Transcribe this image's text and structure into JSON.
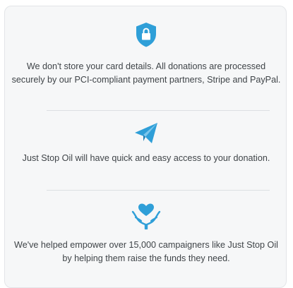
{
  "trust_panel": {
    "items": [
      {
        "icon": "shield-lock-icon",
        "text": "We don't store your card details. All donations are processed securely by our PCI-compliant payment partners, Stripe and PayPal."
      },
      {
        "icon": "paper-plane-icon",
        "text": "Just Stop Oil will have quick and easy access to your donation."
      },
      {
        "icon": "heart-hands-icon",
        "text": "We've helped empower over 15,000 campaigners like Just Stop Oil by helping them raise the funds they need."
      }
    ],
    "colors": {
      "icon_blue": "#2f9fd8",
      "text": "#3f4448",
      "card_bg": "#f6f7f8",
      "divider": "#dcdfe2"
    }
  }
}
